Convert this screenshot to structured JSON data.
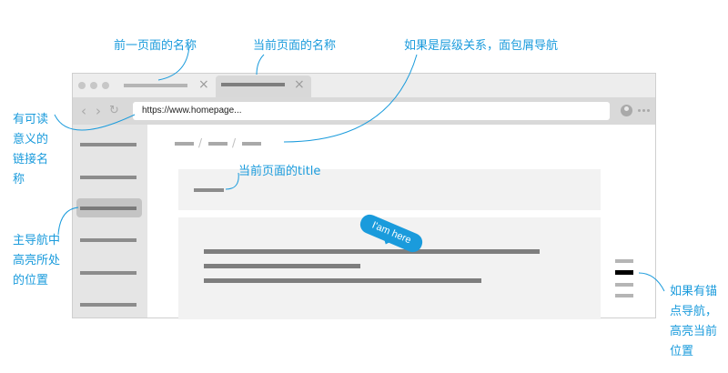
{
  "annotations": {
    "prev_tab": "前一页面的名称",
    "current_tab": "当前页面的名称",
    "breadcrumb": "如果是层级关系，面包屑导航",
    "url": "有可读\n意义的\n链接名\n称",
    "page_title": "当前页面的title",
    "main_nav": "主导航中\n高亮所处\n的位置",
    "anchor_nav": "如果有锚\n点导航，\n高亮当前\n位置"
  },
  "browser": {
    "url_text": "https://www.homepage...",
    "tab_close_glyph": "×",
    "breadcrumb_separator": "/"
  },
  "badge": {
    "text": "I'am here"
  },
  "colors": {
    "accent": "#1a9bdc",
    "chrome": "#e3e3e3",
    "sidebar": "#e5e5e5",
    "highlight": "#c4c4c4",
    "placeholder": "#8c8c8c",
    "anchor_active": "#000000"
  },
  "icons": {
    "back": "chevron-left-icon",
    "forward": "chevron-right-icon",
    "refresh": "refresh-icon",
    "user": "user-icon",
    "more": "more-icon"
  }
}
